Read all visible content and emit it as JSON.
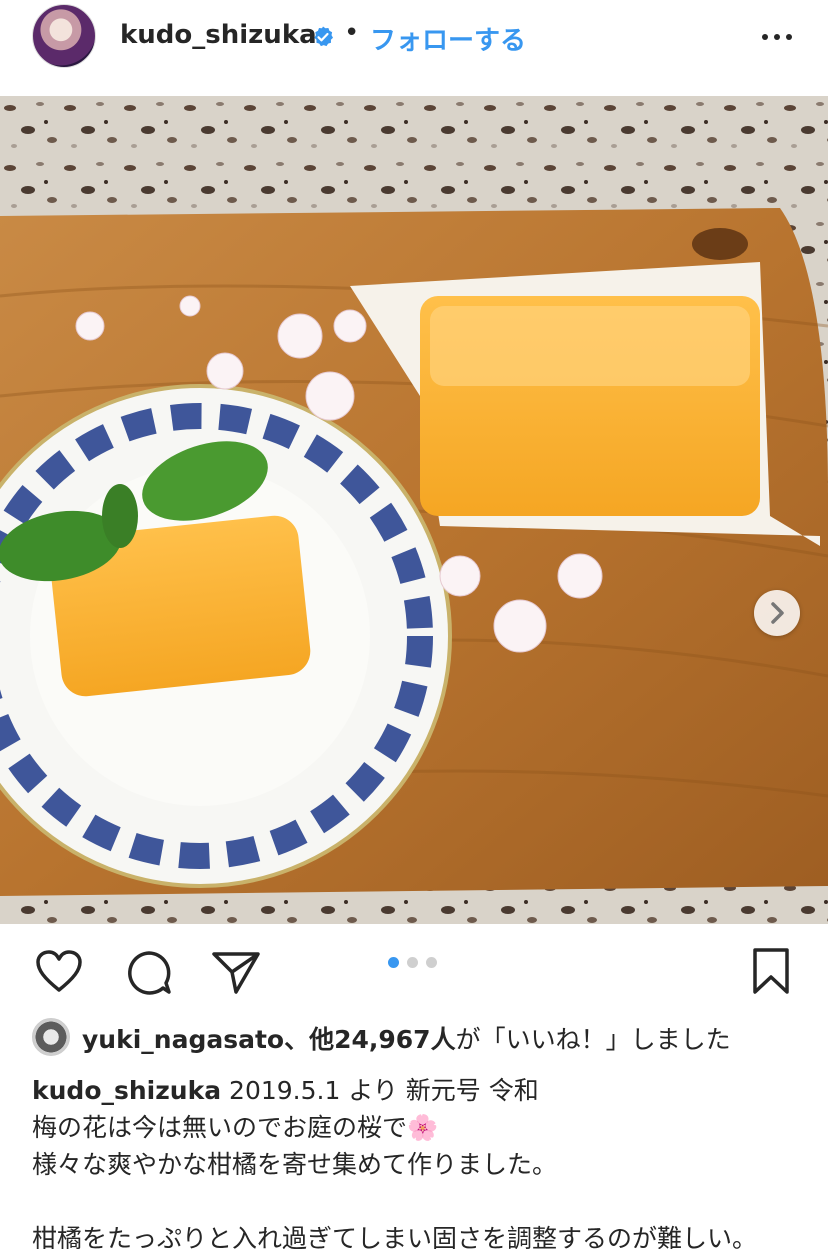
{
  "header": {
    "username": "kudo_shizuka",
    "separator": "•",
    "follow_label": "フォローする"
  },
  "carousel": {
    "total": 3,
    "active": 1
  },
  "likes": {
    "liker": "yuki_nagasato",
    "rest": "、他24,967人",
    "suffix": "が「いいね！」しました"
  },
  "caption": {
    "username": "kudo_shizuka",
    "line1": "2019.5.1 より 新元号 令和",
    "line2": "梅の花は今は無いのでお庭の桜で🌸",
    "line3": "様々な爽やかな柑橘を寄せ集めて作りました。",
    "line4": "柑橘をたっぷりと入れ過ぎてしまい固さを調整するのが難しい。"
  },
  "colors": {
    "accent": "#3897f0",
    "text": "#262626"
  }
}
